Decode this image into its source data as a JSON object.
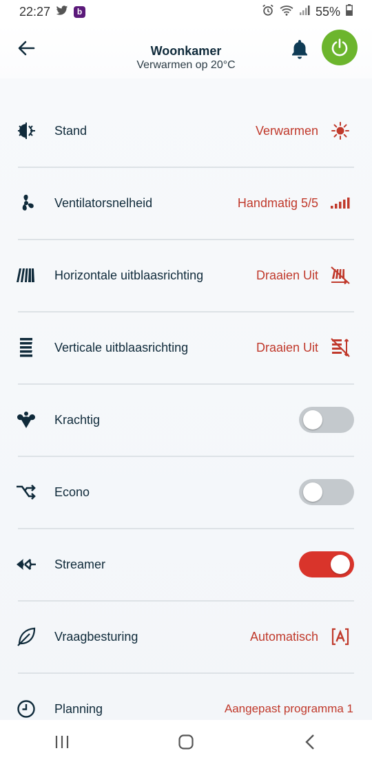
{
  "status_bar": {
    "time": "22:27",
    "app_badge": "b",
    "battery": "55%"
  },
  "header": {
    "title": "Woonkamer",
    "subtitle": "Verwarmen op 20°C"
  },
  "rows": [
    {
      "label": "Stand",
      "value": "Verwarmen",
      "icon": "mode-icon",
      "right_icon": "sun-icon"
    },
    {
      "label": "Ventilatorsnelheid",
      "value": "Handmatig 5/5",
      "icon": "fan-icon",
      "right_icon": "signal-bars-icon"
    },
    {
      "label": "Horizontale uitblaasrichting",
      "value": "Draaien Uit",
      "icon": "horizontal-louver-icon",
      "right_icon": "horizontal-swing-off-icon"
    },
    {
      "label": "Verticale uitblaasrichting",
      "value": "Draaien Uit",
      "icon": "vertical-louver-icon",
      "right_icon": "vertical-swing-off-icon"
    },
    {
      "label": "Krachtig",
      "toggle": false,
      "icon": "powerful-icon"
    },
    {
      "label": "Econo",
      "toggle": false,
      "icon": "econo-icon"
    },
    {
      "label": "Streamer",
      "toggle": true,
      "icon": "streamer-icon"
    },
    {
      "label": "Vraagbesturing",
      "value": "Automatisch",
      "icon": "leaf-icon",
      "right_icon": "auto-a-icon"
    },
    {
      "label": "Planning",
      "value": "Aangepast programma 1",
      "icon": "clock-icon"
    }
  ],
  "colors": {
    "accent": "#c0392b",
    "power_green": "#6cb52d",
    "toggle_on": "#d9342b",
    "toggle_off": "#c4c9cd",
    "text": "#0f2a3a"
  }
}
